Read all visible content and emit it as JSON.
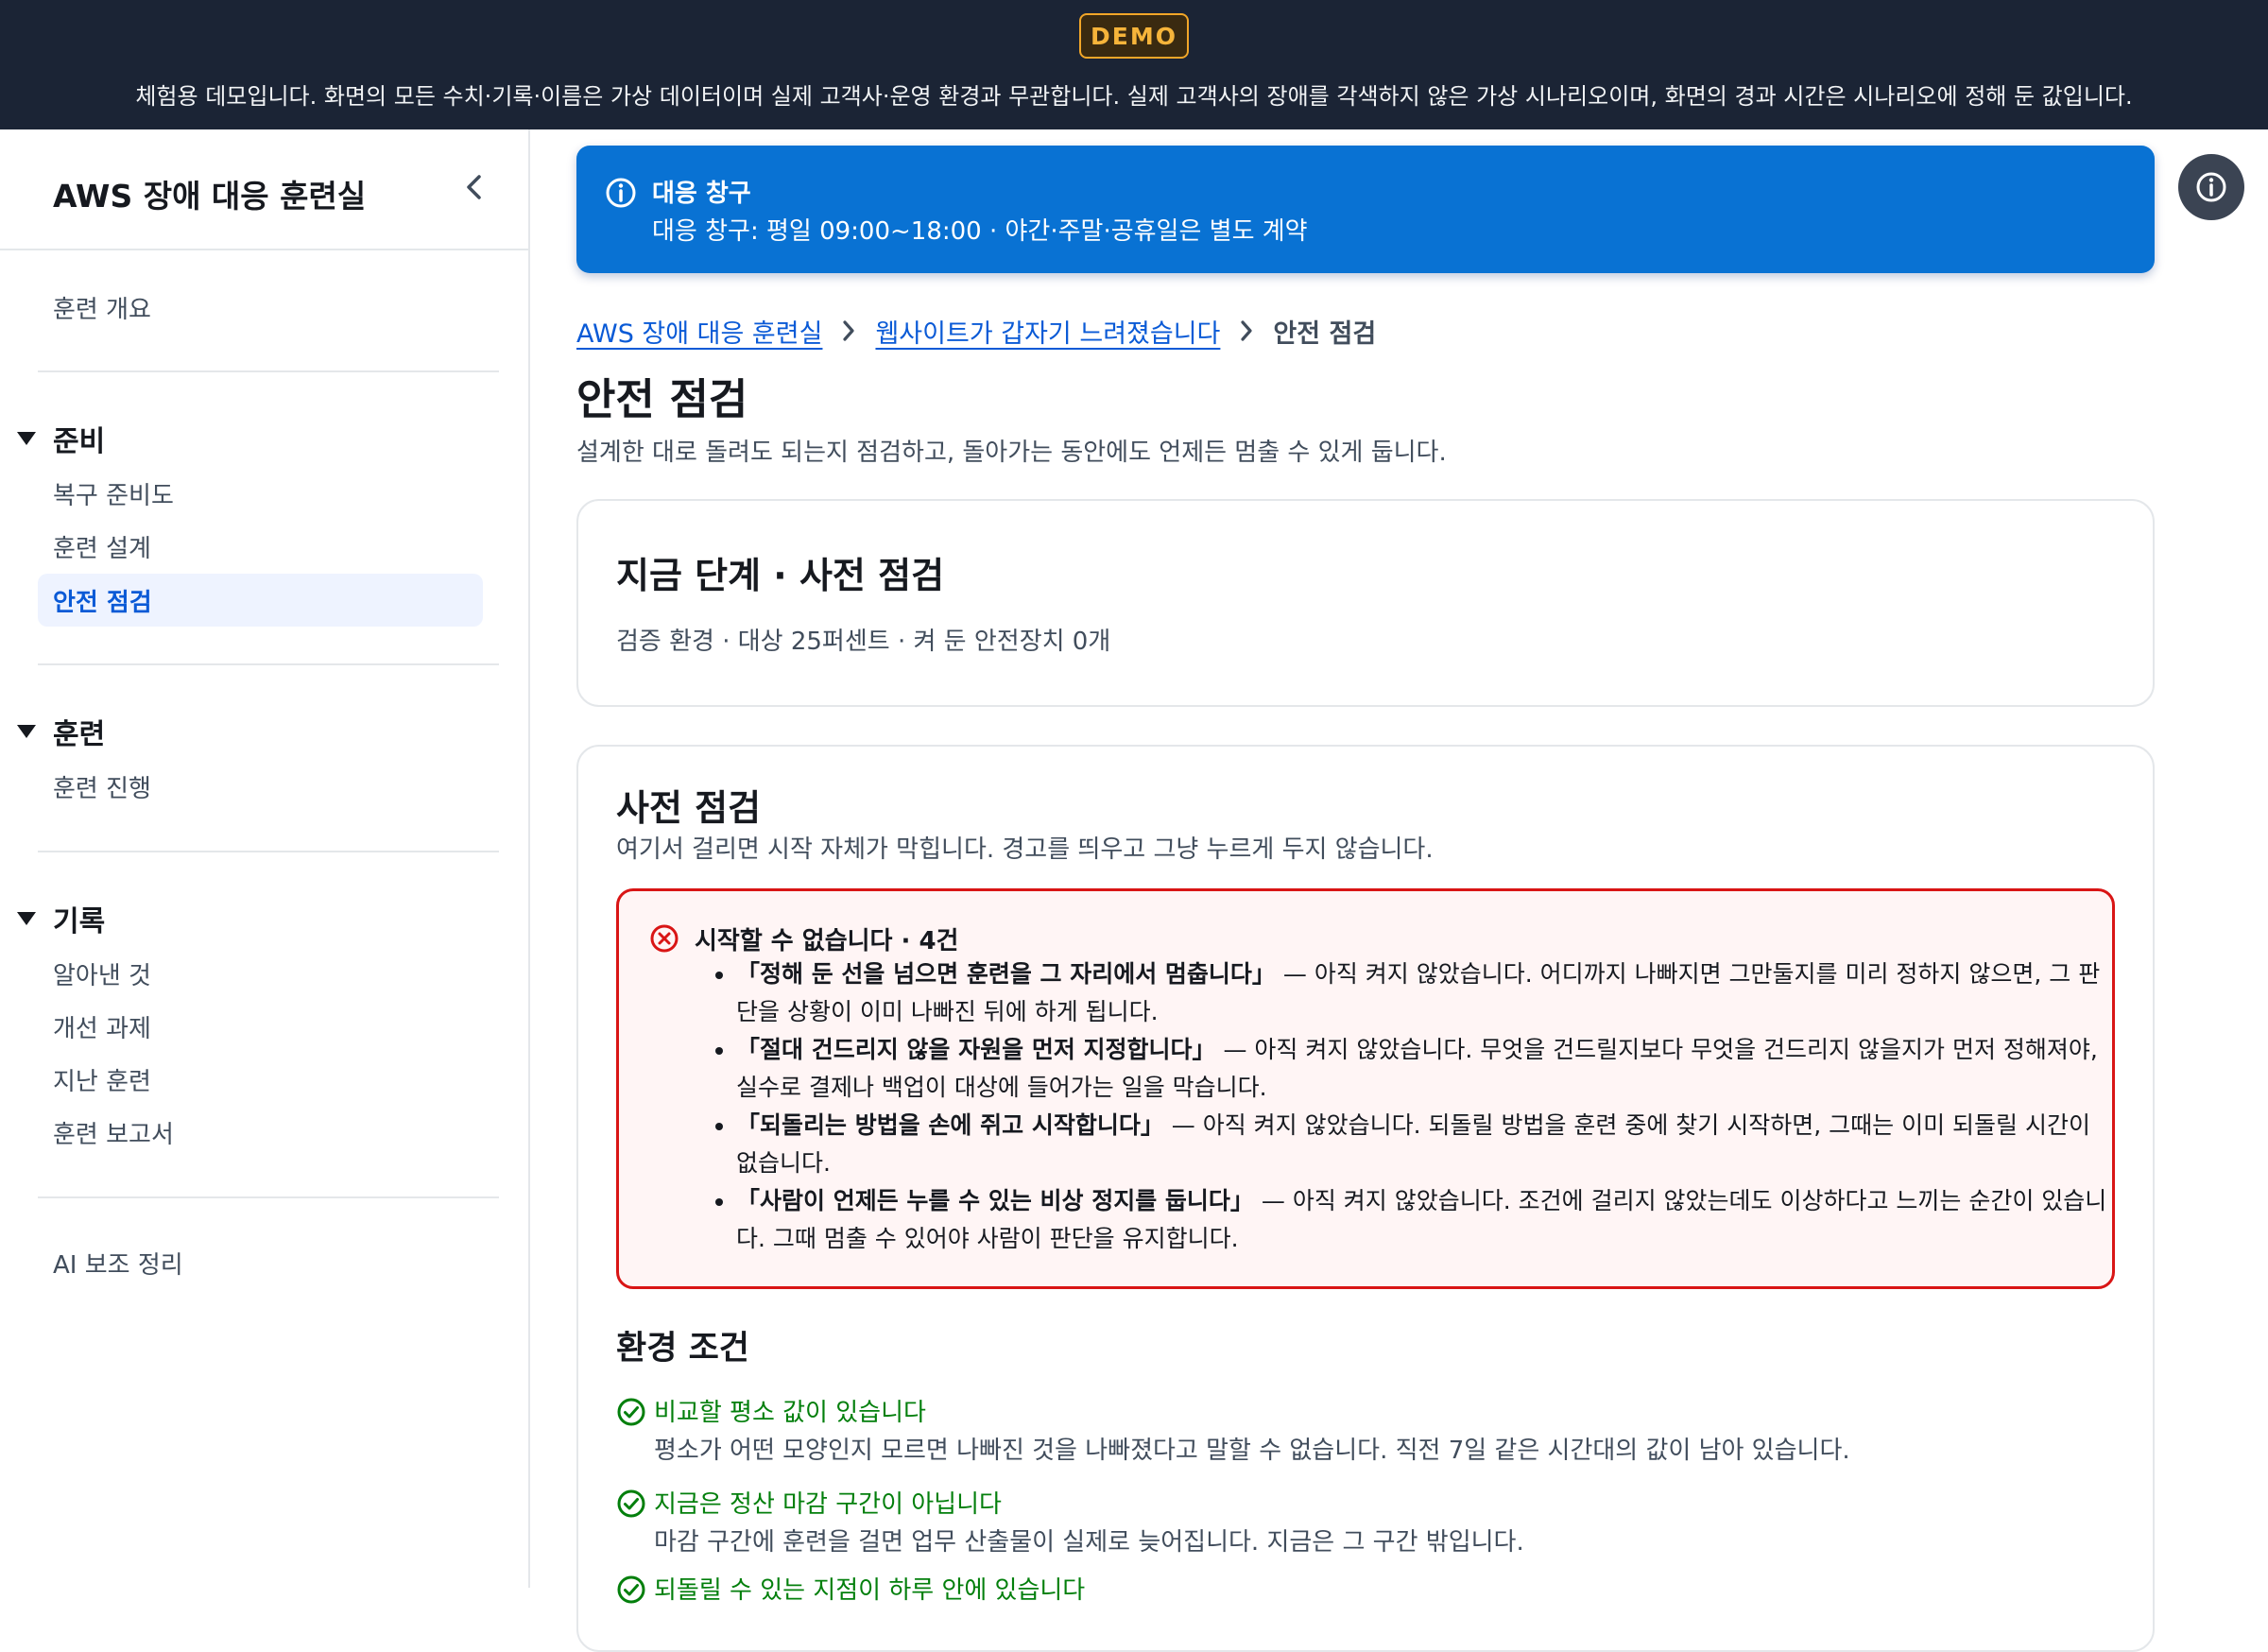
{
  "demo": {
    "badge": "DEMO",
    "notice": "체험용 데모입니다. 화면의 모든 수치·기록·이름은 가상 데이터이며 실제 고객사·운영 환경과 무관합니다. 실제 고객사의 장애를 각색하지 않은 가상 시나리오이며, 화면의 경과 시간은 시나리오에 정해 둔 값입니다."
  },
  "sidebar": {
    "title": "AWS 장애 대응 훈련실",
    "overview": "훈련 개요",
    "sections": [
      {
        "label": "준비",
        "items": [
          "복구 준비도",
          "훈련 설계",
          "안전 점검"
        ]
      },
      {
        "label": "훈련",
        "items": [
          "훈련 진행"
        ]
      },
      {
        "label": "기록",
        "items": [
          "알아낸 것",
          "개선 과제",
          "지난 훈련",
          "훈련 보고서"
        ]
      }
    ],
    "active_item": "안전 점검",
    "footer_item": "AI 보조 정리"
  },
  "notice": {
    "title": "대응 창구",
    "body": "대응 창구: 평일 09:00~18:00 · 야간·주말·공휴일은 별도 계약"
  },
  "breadcrumb": [
    "AWS 장애 대응 훈련실",
    "웹사이트가 갑자기 느려졌습니다",
    "안전 점검"
  ],
  "page": {
    "title": "안전 점검",
    "description": "설계한 대로 돌려도 되는지 점검하고, 돌아가는 동안에도 언제든 멈출 수 있게 둡니다."
  },
  "stage": {
    "title": "지금 단계 · 사전 점검",
    "summary": "검증 환경 · 대상 25퍼센트 · 켜 둔 안전장치 0개"
  },
  "precheck": {
    "title": "사전 점검",
    "subtitle": "여기서 걸리면 시작 자체가 막힙니다. 경고를 띄우고 그냥 누르게 두지 않습니다.",
    "blocker": {
      "title": "시작할 수 없습니다 · 4건",
      "items": [
        {
          "name": "「정해 둔 선을 넘으면 훈련을 그 자리에서 멈춥니다」",
          "text": " — 아직 켜지 않았습니다. 어디까지 나빠지면 그만둘지를 미리 정하지 않으면, 그 판단을 상황이 이미 나빠진 뒤에 하게 됩니다."
        },
        {
          "name": "「절대 건드리지 않을 자원을 먼저 지정합니다」",
          "text": " — 아직 켜지 않았습니다. 무엇을 건드릴지보다 무엇을 건드리지 않을지가 먼저 정해져야, 실수로 결제나 백업이 대상에 들어가는 일을 막습니다."
        },
        {
          "name": "「되돌리는 방법을 손에 쥐고 시작합니다」",
          "text": " — 아직 켜지 않았습니다. 되돌릴 방법을 훈련 중에 찾기 시작하면, 그때는 이미 되돌릴 시간이 없습니다."
        },
        {
          "name": "「사람이 언제든 누를 수 있는 비상 정지를 둡니다」",
          "text": " — 아직 켜지 않았습니다. 조건에 걸리지 않았는데도 이상하다고 느끼는 순간이 있습니다. 그때 멈출 수 있어야 사람이 판단을 유지합니다."
        }
      ]
    },
    "env_title": "환경 조건",
    "env_items": [
      {
        "title": "비교할 평소 값이 있습니다",
        "desc": "평소가 어떤 모양인지 모르면 나빠진 것을 나빠졌다고 말할 수 없습니다. 직전 7일 같은 시간대의 값이 남아 있습니다."
      },
      {
        "title": "지금은 정산 마감 구간이 아닙니다",
        "desc": "마감 구간에 훈련을 걸면 업무 산출물이 실제로 늦어집니다. 지금은 그 구간 밖입니다."
      },
      {
        "title": "되돌릴 수 있는 지점이 하루 안에 있습니다",
        "desc": ""
      }
    ]
  },
  "colors": {
    "banner_bg": "#1b2435",
    "badge": "#f2a628",
    "accent": "#0972d3",
    "error": "#d91515",
    "success": "#037f0c"
  }
}
